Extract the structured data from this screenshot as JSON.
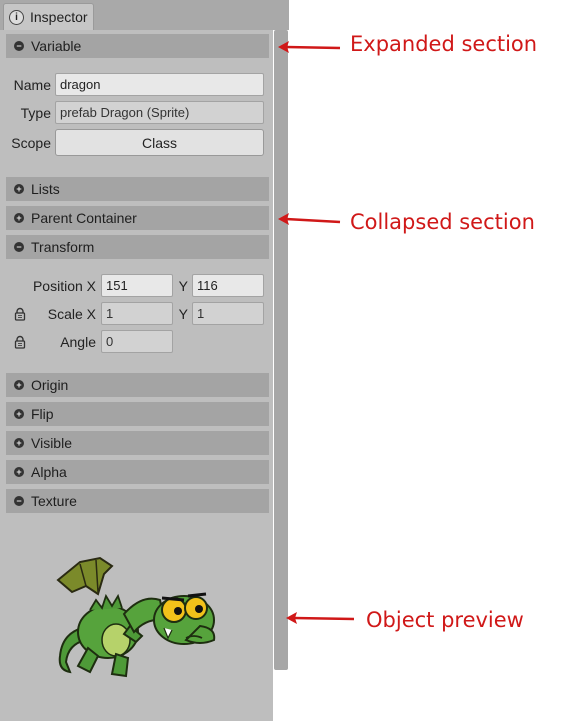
{
  "tab": {
    "icon": "info-icon",
    "label": "Inspector"
  },
  "sections": {
    "variable": {
      "label": "Variable",
      "state": "expanded"
    },
    "lists": {
      "label": "Lists",
      "state": "collapsed"
    },
    "parent_container": {
      "label": "Parent Container",
      "state": "collapsed"
    },
    "transform": {
      "label": "Transform",
      "state": "expanded"
    },
    "origin": {
      "label": "Origin",
      "state": "collapsed"
    },
    "flip": {
      "label": "Flip",
      "state": "collapsed"
    },
    "visible": {
      "label": "Visible",
      "state": "collapsed"
    },
    "alpha": {
      "label": "Alpha",
      "state": "collapsed"
    },
    "texture": {
      "label": "Texture",
      "state": "expanded"
    }
  },
  "variable": {
    "name_label": "Name",
    "name_value": "dragon",
    "type_label": "Type",
    "type_value": "prefab Dragon (Sprite)",
    "scope_label": "Scope",
    "scope_value": "Class"
  },
  "transform": {
    "position_label": "Position X",
    "position_x": "151",
    "position_y_label": "Y",
    "position_y": "116",
    "scale_label": "Scale X",
    "scale_x": "1",
    "scale_y_label": "Y",
    "scale_y": "1",
    "angle_label": "Angle",
    "angle": "0"
  },
  "annotations": {
    "expanded": "Expanded section",
    "collapsed": "Collapsed section",
    "preview": "Object preview"
  },
  "colors": {
    "annotation": "#d01818",
    "header": "#a4a4a4",
    "panel": "#bebebe"
  }
}
